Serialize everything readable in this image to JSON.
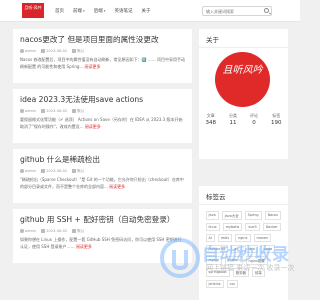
{
  "header": {
    "logo_text": "且听·风吟",
    "nav": [
      {
        "label": "首页",
        "has_dropdown": false
      },
      {
        "label": "前端",
        "has_dropdown": true
      },
      {
        "label": "后端",
        "has_dropdown": true
      },
      {
        "label": "英语笔记",
        "has_dropdown": false
      },
      {
        "label": "关于",
        "has_dropdown": false
      }
    ],
    "search_placeholder": "输入关键词搜索"
  },
  "posts": [
    {
      "title": "nacos更改了 但是项目里面的属性没更改",
      "author": "admin",
      "date": "2023-06-02",
      "category": "默认",
      "excerpt": "Nacos 修改配置后，项目中的属性值没有自动刷新，常见原因如下：1️⃣ …… 项目中采用手动刷新配置 的可能性和使用 Spring...",
      "read_more": "阅读更多"
    },
    {
      "title": "idea 2023.3无法使用save actions",
      "author": "admin",
      "date": "2023-06-02",
      "category": "默认",
      "excerpt": "要保留格式化等功能（✔ 选项） Actions on Save（另存时）在 IDEA 从 2023.3 版本开始取消了\"保存时操作\"，改成内置设...",
      "read_more": "阅读更多"
    },
    {
      "title": "github 什么是稀疏检出",
      "author": "admin",
      "date": "2023-06-02",
      "category": "默认",
      "excerpt": "\"稀疏检出（Sparse Checkout）\"是 Git 的一个功能，它允许你只检出（checkout）仓库中的部分目录或文件，而不是整个仓库的全部内容...",
      "read_more": "阅读更多"
    },
    {
      "title": "github 用 SSH + 配好密钥（自动免密登录）",
      "author": "admin",
      "date": "2023-06-02",
      "category": "默认",
      "excerpt": "如果你想在 Linux 上操作，配置一套 GitHub SSH 免密码访问，你可以使用 SSH 密钥进行认证，使用 SSH 登录账户……",
      "read_more": "阅读更多"
    }
  ],
  "about": {
    "title": "关于",
    "logo_text": "且听风吟",
    "stats": [
      {
        "label": "文章",
        "value": "348"
      },
      {
        "label": "分类",
        "value": "11"
      },
      {
        "label": "评论",
        "value": "0"
      },
      {
        "label": "标签",
        "value": "190"
      }
    ]
  },
  "tags": {
    "title": "标签云",
    "items": [
      "Java",
      "Java大全",
      "Spring",
      "Nacos",
      "linux",
      "mybatis",
      "vue3",
      "Docker",
      "AI",
      "redis",
      "nginx",
      "maven",
      "javascript",
      "git",
      "idea",
      "node",
      "mysql",
      "python",
      "nginx配置",
      "springboot",
      "服务器",
      "前端",
      "jenkins",
      "css"
    ]
  },
  "watermark": {
    "title": "自动秒收录",
    "subtitle": "网上链接 来访一次 收录一次"
  },
  "colors": {
    "accent": "#d9262a",
    "background": "#f0f0f0",
    "card": "#ffffff"
  }
}
